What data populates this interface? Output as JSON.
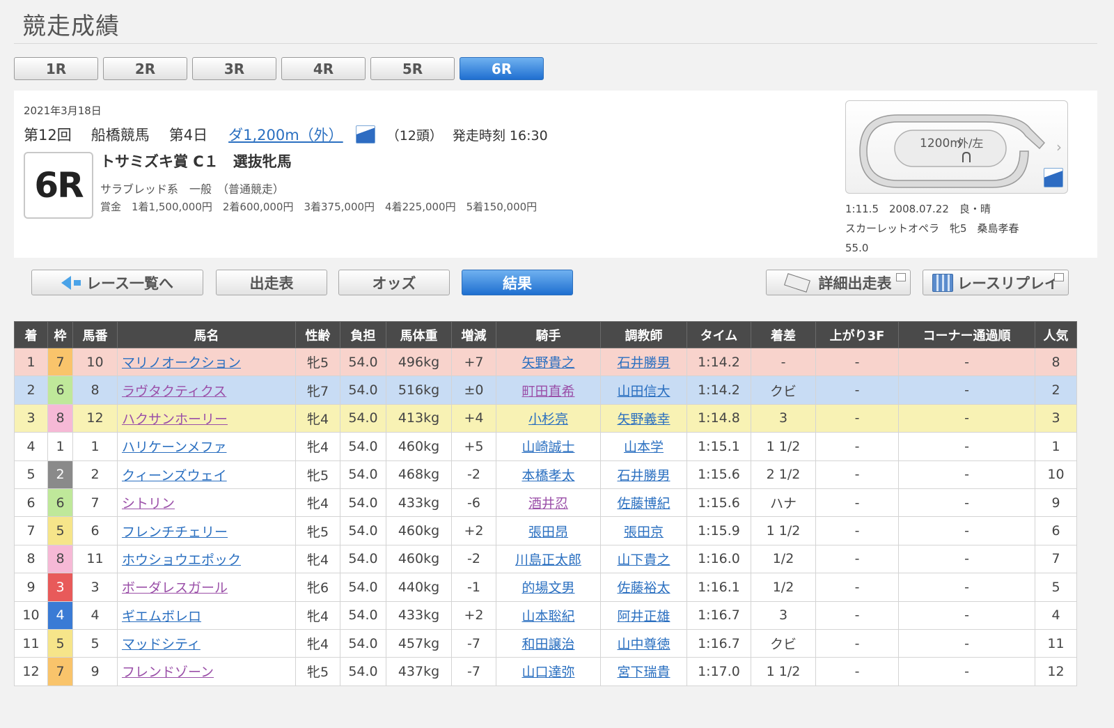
{
  "page": {
    "title": "競走成績"
  },
  "race_tabs": [
    {
      "label": "1R",
      "active": false
    },
    {
      "label": "2R",
      "active": false
    },
    {
      "label": "3R",
      "active": false
    },
    {
      "label": "4R",
      "active": false
    },
    {
      "label": "5R",
      "active": false
    },
    {
      "label": "6R",
      "active": true
    }
  ],
  "race_info": {
    "date": "2021年3月18日",
    "meeting": "第12回",
    "venue": "船橋競馬",
    "day": "第4日",
    "course": "ダ1,200m（外）",
    "heads": "（12頭）",
    "post_time": "発走時刻 16:30",
    "race_number": "6R",
    "race_name": "トサミズキ賞 C１　選抜牝馬",
    "conditions": "サラブレッド系　一般　（普通競走）",
    "prize": "賞金　1着1,500,000円　2着600,000円　3着375,000円　4着225,000円　5着150,000円"
  },
  "course_map": {
    "distance_label": "1200m",
    "direction_label": "外/左",
    "accent_color": "#2e6cc2"
  },
  "record": {
    "line1": "1:11.5　2008.07.22　良・晴",
    "line2": "スカーレットオペラ　牝5　桑島孝春",
    "line3": "55.0"
  },
  "nav": {
    "back": "レース一覧へ",
    "entries": "出走表",
    "odds": "オッズ",
    "results": "結果",
    "detail_entries": "詳細出走表",
    "replay": "レースリプレイ"
  },
  "table": {
    "headers": [
      "着",
      "枠",
      "馬番",
      "馬名",
      "性齢",
      "負担",
      "馬体重",
      "増減",
      "騎手",
      "調教師",
      "タイム",
      "着差",
      "上がり3F",
      "コーナー通過順",
      "人気"
    ],
    "frame_colors": {
      "1": {
        "bg": "#ffffff",
        "fg": "#444444"
      },
      "2": {
        "bg": "#8a8a8a",
        "fg": "#ffffff"
      },
      "3": {
        "bg": "#e85a5a",
        "fg": "#ffffff"
      },
      "4": {
        "bg": "#3a7bd5",
        "fg": "#ffffff"
      },
      "5": {
        "bg": "#f6e58a",
        "fg": "#444444"
      },
      "6": {
        "bg": "#bfe89a",
        "fg": "#444444"
      },
      "7": {
        "bg": "#f9c46b",
        "fg": "#444444"
      },
      "8": {
        "bg": "#f6b9d6",
        "fg": "#444444"
      }
    },
    "rows": [
      {
        "rank": "1",
        "frame": "7",
        "num": "10",
        "horse": "マリノオークション",
        "sexage": "牝5",
        "weight_carried": "54.0",
        "body_weight": "496kg",
        "change": "+7",
        "jockey": "矢野貴之",
        "trainer": "石井勝男",
        "time": "1:14.2",
        "margin": "-",
        "last3f": "-",
        "corners": "-",
        "pop": "8",
        "horse_visited": false,
        "jockey_visited": false
      },
      {
        "rank": "2",
        "frame": "6",
        "num": "8",
        "horse": "ラヴタクティクス",
        "sexage": "牝7",
        "weight_carried": "54.0",
        "body_weight": "516kg",
        "change": "±0",
        "jockey": "町田直希",
        "trainer": "山田信大",
        "time": "1:14.2",
        "margin": "クビ",
        "last3f": "-",
        "corners": "-",
        "pop": "2",
        "horse_visited": true,
        "jockey_visited": true
      },
      {
        "rank": "3",
        "frame": "8",
        "num": "12",
        "horse": "ハクサンホーリー",
        "sexage": "牝4",
        "weight_carried": "54.0",
        "body_weight": "413kg",
        "change": "+4",
        "jockey": "小杉亮",
        "trainer": "矢野義幸",
        "time": "1:14.8",
        "margin": "3",
        "last3f": "-",
        "corners": "-",
        "pop": "3",
        "horse_visited": true,
        "jockey_visited": false
      },
      {
        "rank": "4",
        "frame": "1",
        "num": "1",
        "horse": "ハリケーンメファ",
        "sexage": "牝4",
        "weight_carried": "54.0",
        "body_weight": "460kg",
        "change": "+5",
        "jockey": "山崎誠士",
        "trainer": "山本学",
        "time": "1:15.1",
        "margin": "1 1/2",
        "last3f": "-",
        "corners": "-",
        "pop": "1",
        "horse_visited": false,
        "jockey_visited": false
      },
      {
        "rank": "5",
        "frame": "2",
        "num": "2",
        "horse": "クィーンズウェイ",
        "sexage": "牝5",
        "weight_carried": "54.0",
        "body_weight": "468kg",
        "change": "-2",
        "jockey": "本橋孝太",
        "trainer": "石井勝男",
        "time": "1:15.6",
        "margin": "2 1/2",
        "last3f": "-",
        "corners": "-",
        "pop": "10",
        "horse_visited": false,
        "jockey_visited": false
      },
      {
        "rank": "6",
        "frame": "6",
        "num": "7",
        "horse": "シトリン",
        "sexage": "牝4",
        "weight_carried": "54.0",
        "body_weight": "433kg",
        "change": "-6",
        "jockey": "酒井忍",
        "trainer": "佐藤博紀",
        "time": "1:15.6",
        "margin": "ハナ",
        "last3f": "-",
        "corners": "-",
        "pop": "9",
        "horse_visited": true,
        "jockey_visited": true
      },
      {
        "rank": "7",
        "frame": "5",
        "num": "6",
        "horse": "フレンチチェリー",
        "sexage": "牝5",
        "weight_carried": "54.0",
        "body_weight": "460kg",
        "change": "+2",
        "jockey": "張田昂",
        "trainer": "張田京",
        "time": "1:15.9",
        "margin": "1 1/2",
        "last3f": "-",
        "corners": "-",
        "pop": "6",
        "horse_visited": false,
        "jockey_visited": false
      },
      {
        "rank": "8",
        "frame": "8",
        "num": "11",
        "horse": "ホウショウエポック",
        "sexage": "牝4",
        "weight_carried": "54.0",
        "body_weight": "460kg",
        "change": "-2",
        "jockey": "川島正太郎",
        "trainer": "山下貴之",
        "time": "1:16.0",
        "margin": "1/2",
        "last3f": "-",
        "corners": "-",
        "pop": "7",
        "horse_visited": false,
        "jockey_visited": false
      },
      {
        "rank": "9",
        "frame": "3",
        "num": "3",
        "horse": "ボーダレスガール",
        "sexage": "牝6",
        "weight_carried": "54.0",
        "body_weight": "440kg",
        "change": "-1",
        "jockey": "的場文男",
        "trainer": "佐藤裕太",
        "time": "1:16.1",
        "margin": "1/2",
        "last3f": "-",
        "corners": "-",
        "pop": "5",
        "horse_visited": true,
        "jockey_visited": false
      },
      {
        "rank": "10",
        "frame": "4",
        "num": "4",
        "horse": "ギエムボレロ",
        "sexage": "牝4",
        "weight_carried": "54.0",
        "body_weight": "433kg",
        "change": "+2",
        "jockey": "山本聡紀",
        "trainer": "阿井正雄",
        "time": "1:16.7",
        "margin": "3",
        "last3f": "-",
        "corners": "-",
        "pop": "4",
        "horse_visited": false,
        "jockey_visited": false
      },
      {
        "rank": "11",
        "frame": "5",
        "num": "5",
        "horse": "マッドシティ",
        "sexage": "牝4",
        "weight_carried": "54.0",
        "body_weight": "457kg",
        "change": "-7",
        "jockey": "和田譲治",
        "trainer": "山中尊徳",
        "time": "1:16.7",
        "margin": "クビ",
        "last3f": "-",
        "corners": "-",
        "pop": "11",
        "horse_visited": false,
        "jockey_visited": false
      },
      {
        "rank": "12",
        "frame": "7",
        "num": "9",
        "horse": "フレンドゾーン",
        "sexage": "牝5",
        "weight_carried": "54.0",
        "body_weight": "437kg",
        "change": "-7",
        "jockey": "山口達弥",
        "trainer": "宮下瑞貴",
        "time": "1:17.0",
        "margin": "1 1/2",
        "last3f": "-",
        "corners": "-",
        "pop": "12",
        "horse_visited": true,
        "jockey_visited": false
      }
    ]
  }
}
